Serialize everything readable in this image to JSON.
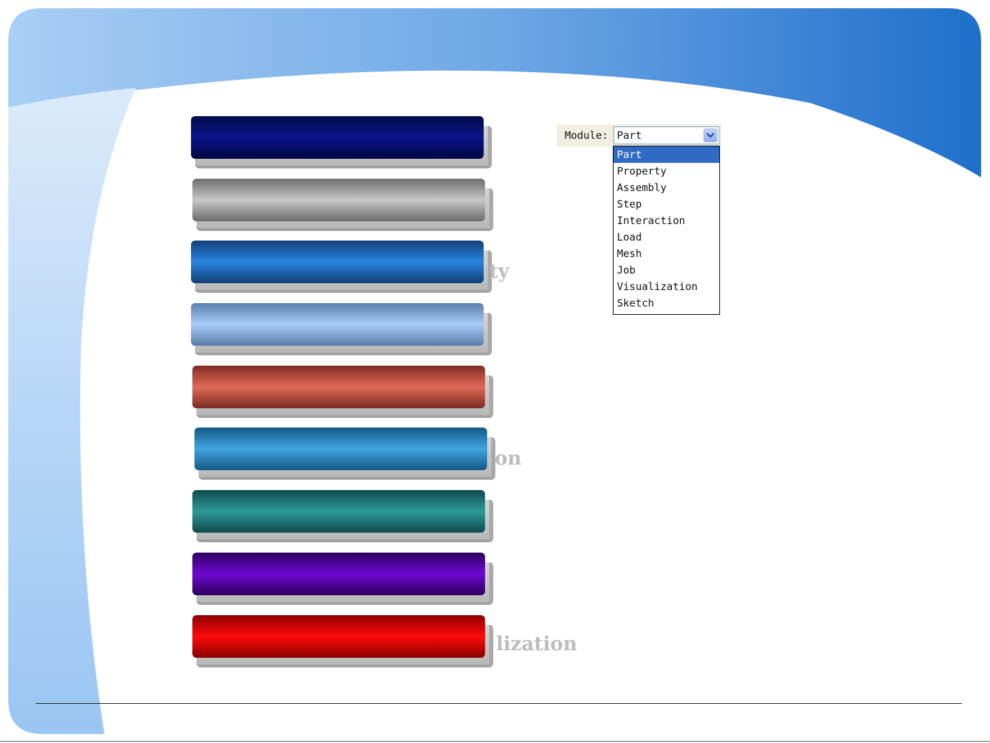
{
  "module_selector": {
    "label": "Module:",
    "selected_value": "Part",
    "options": [
      "Part",
      "Property",
      "Assembly",
      "Step",
      "Interaction",
      "Load",
      "Mesh",
      "Job",
      "Visualization",
      "Sketch"
    ]
  },
  "bar_labels": {
    "third": "ty",
    "sixth": "on",
    "ninth": "lization"
  },
  "colors": {
    "header_blue": "#2471c8",
    "header_light": "#a9cff5",
    "selection": "#316ac5",
    "bar_navy": "#0a0f6e",
    "bar_gray": "#a6a6a6",
    "bar_blue": "#1e73c9",
    "bar_lightblue": "#9cc3f1",
    "bar_salmon": "#d95f4f",
    "bar_cyan": "#3a9dd6",
    "bar_teal": "#2a8c8c",
    "bar_purple": "#6a00c8",
    "bar_red": "#ee0000"
  }
}
